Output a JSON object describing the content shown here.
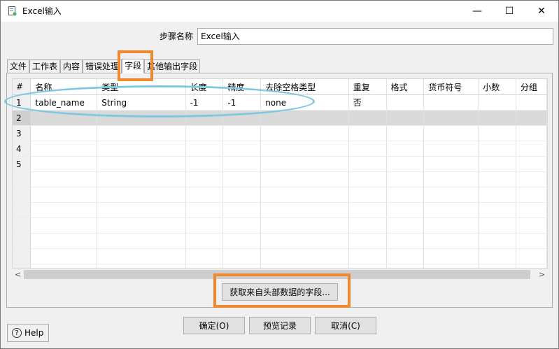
{
  "window": {
    "title": "Excel输入",
    "minimize": "—",
    "maximize": "☐",
    "close": "✕"
  },
  "step": {
    "label": "步骤名称",
    "value": "Excel输入"
  },
  "tabs": [
    "文件",
    "工作表",
    "内容",
    "错误处理",
    "字段",
    "其他输出字段"
  ],
  "active_tab": "字段",
  "grid": {
    "columns": [
      "#",
      "名称",
      "类型",
      "长度",
      "精度",
      "去除空格类型",
      "重复",
      "格式",
      "货币符号",
      "小数",
      "分组"
    ],
    "rows": [
      [
        "1",
        "table_name",
        "String",
        "-1",
        "-1",
        "none",
        "否",
        "",
        "",
        "",
        ""
      ],
      [
        "2",
        "",
        "",
        "",
        "",
        "",
        "",
        "",
        "",
        "",
        ""
      ],
      [
        "3",
        "",
        "",
        "",
        "",
        "",
        "",
        "",
        "",
        "",
        ""
      ],
      [
        "4",
        "",
        "",
        "",
        "",
        "",
        "",
        "",
        "",
        "",
        ""
      ],
      [
        "5",
        "",
        "",
        "",
        "",
        "",
        "",
        "",
        "",
        "",
        ""
      ],
      [
        "",
        "",
        "",
        "",
        "",
        "",
        "",
        "",
        "",
        "",
        ""
      ],
      [
        "",
        "",
        "",
        "",
        "",
        "",
        "",
        "",
        "",
        "",
        ""
      ],
      [
        "",
        "",
        "",
        "",
        "",
        "",
        "",
        "",
        "",
        "",
        ""
      ],
      [
        "",
        "",
        "",
        "",
        "",
        "",
        "",
        "",
        "",
        "",
        ""
      ],
      [
        "",
        "",
        "",
        "",
        "",
        "",
        "",
        "",
        "",
        "",
        ""
      ],
      [
        "",
        "",
        "",
        "",
        "",
        "",
        "",
        "",
        "",
        "",
        ""
      ],
      [
        "",
        "",
        "",
        "",
        "",
        "",
        "",
        "",
        "",
        "",
        ""
      ]
    ],
    "selected_row": 2
  },
  "scroll": {
    "left": "<",
    "right": ">"
  },
  "get_fields_button": "获取来自头部数据的字段...",
  "buttons": {
    "ok": "确定(O)",
    "preview": "预览记录",
    "cancel": "取消(C)"
  },
  "help": {
    "icon": "?",
    "label": "Help"
  },
  "colors": {
    "highlight_orange": "#f0882e",
    "highlight_blue": "#7fc7e0"
  }
}
